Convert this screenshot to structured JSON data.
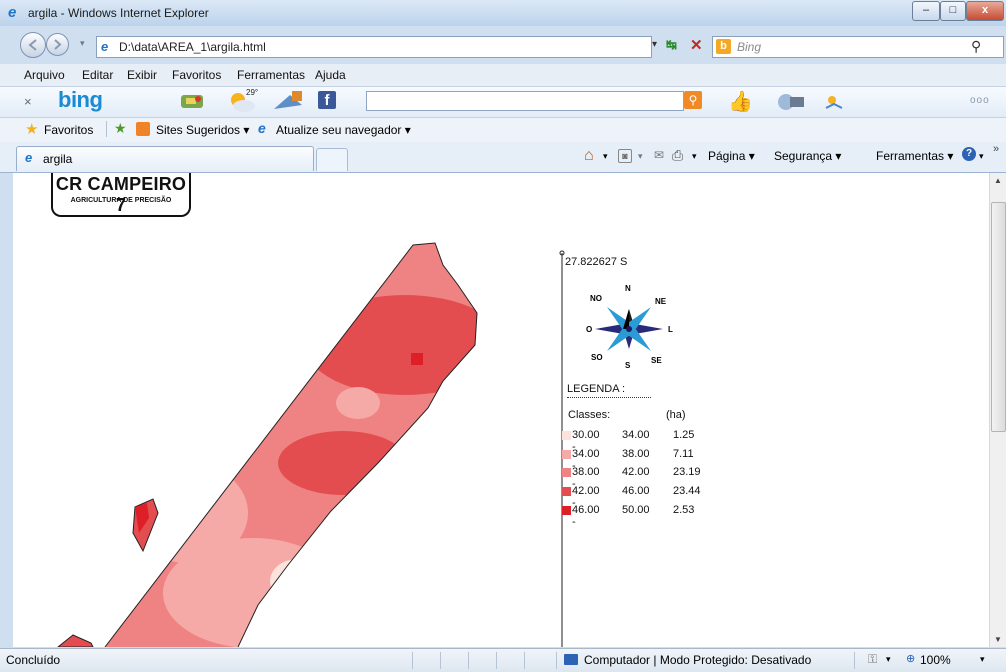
{
  "window": {
    "title": "argila - Windows Internet Explorer",
    "minimize": "–",
    "maximize": "□",
    "close": "x"
  },
  "address": {
    "url": "D:\\data\\AREA_1\\argila.html",
    "search_placeholder": "Bing"
  },
  "menu": {
    "items": [
      "Arquivo",
      "Editar",
      "Exibir",
      "Favoritos",
      "Ferramentas",
      "Ajuda"
    ]
  },
  "bingbar": {
    "logo": "bing",
    "weather": "29°",
    "more": "ooo"
  },
  "favorites": {
    "label": "Favoritos",
    "sites": "Sites Sugeridos ▾",
    "update": "Atualize seu navegador ▾"
  },
  "tab": {
    "label": "argila"
  },
  "commandbar": {
    "page": "Página ▾",
    "security": "Segurança ▾",
    "tools": "Ferramentas ▾"
  },
  "logo": {
    "title": "CR CAMPEIRO 7",
    "subtitle": "AGRICULTURA DE PRECISÃO"
  },
  "map": {
    "coordinate": "27.822627 S",
    "compass": {
      "n": "N",
      "s": "S",
      "l": "L",
      "o": "O",
      "ne": "NE",
      "no": "NO",
      "se": "SE",
      "so": "SO"
    },
    "legend_title": "LEGENDA :",
    "legend_header": {
      "classes": "Classes:",
      "unit": "(ha)"
    },
    "legend": [
      {
        "from": "30.00 -",
        "to": "34.00",
        "area": "1.25",
        "color": "#fde2dc"
      },
      {
        "from": "34.00 -",
        "to": "38.00",
        "area": "7.11",
        "color": "#f6aaa8"
      },
      {
        "from": "38.00 -",
        "to": "42.00",
        "area": "23.19",
        "color": "#ef8383"
      },
      {
        "from": "42.00 -",
        "to": "46.00",
        "area": "23.44",
        "color": "#e44d50"
      },
      {
        "from": "46.00 -",
        "to": "50.00",
        "area": "2.53",
        "color": "#dd1f27"
      }
    ]
  },
  "status": {
    "text": "Concluído",
    "zone": "Computador | Modo Protegido: Desativado",
    "zoom": "100%"
  }
}
